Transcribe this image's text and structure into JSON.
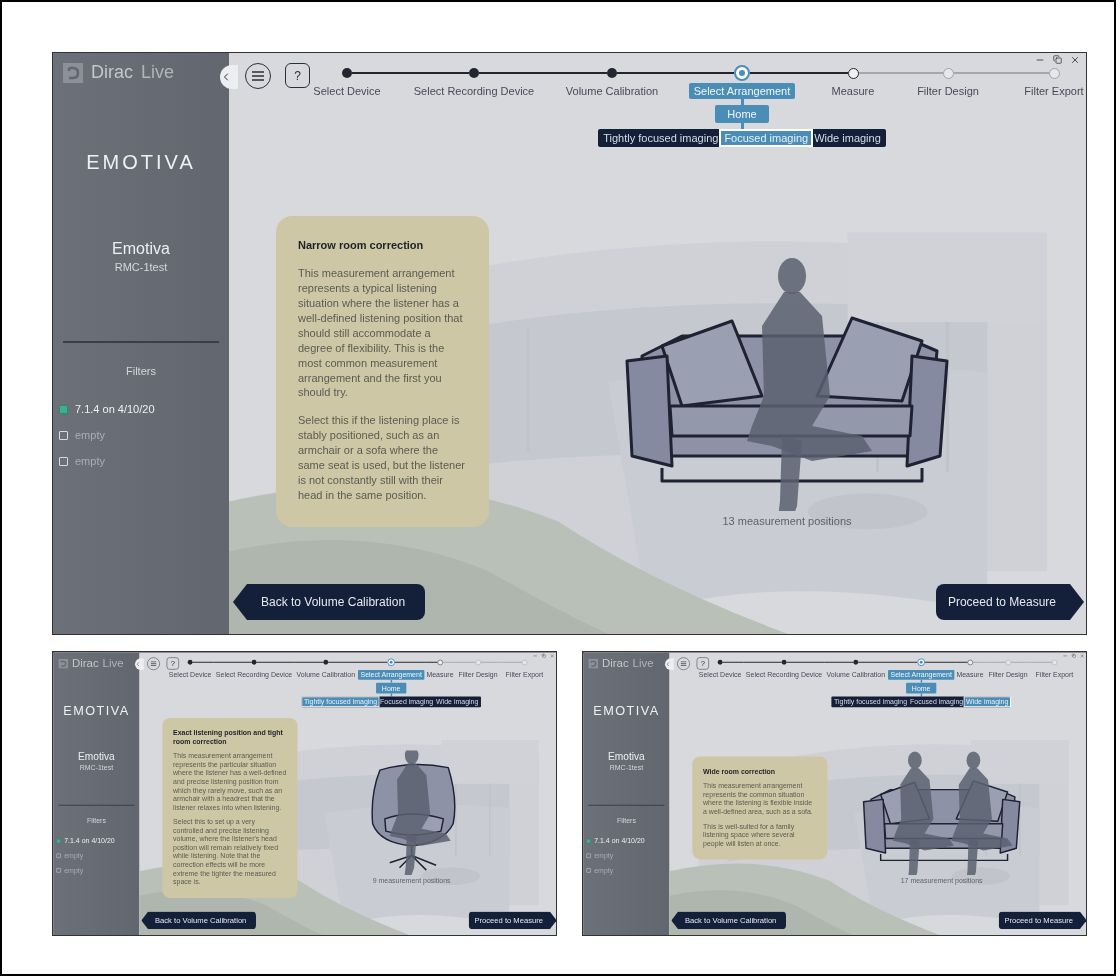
{
  "screens": [
    {
      "sidebar": {
        "brand": "Dirac",
        "brand_suffix": "Live",
        "logo": "EMOTIVA",
        "device_name": "Emotiva",
        "device_model": "RMC-1test",
        "filters_heading": "Filters",
        "filters": [
          {
            "label": "7.1.4 on 4/10/20",
            "checked": true
          },
          {
            "label": "empty",
            "checked": false
          },
          {
            "label": "empty",
            "checked": false
          }
        ]
      },
      "help_label": "?",
      "steps": [
        {
          "label": "Select Device",
          "completed": true,
          "selected": false,
          "enabled": true
        },
        {
          "label": "Select Recording Device",
          "completed": true,
          "selected": false,
          "enabled": true
        },
        {
          "label": "Volume Calibration",
          "completed": true,
          "selected": false,
          "enabled": true
        },
        {
          "label": "Select Arrangement",
          "completed": false,
          "selected": true,
          "enabled": true
        },
        {
          "label": "Measure",
          "completed": false,
          "selected": false,
          "enabled": true
        },
        {
          "label": "Filter Design",
          "completed": false,
          "selected": false,
          "enabled": false
        },
        {
          "label": "Filter Export",
          "completed": false,
          "selected": false,
          "enabled": false
        }
      ],
      "substep": "Home",
      "options": [
        {
          "label": "Tightly focused imaging",
          "selected": false
        },
        {
          "label": "Focused imaging",
          "selected": true
        },
        {
          "label": "Wide imaging",
          "selected": false
        }
      ],
      "card": {
        "title": "Narrow room correction",
        "paragraphs": [
          "This measurement arrangement represents a typical listening situation where the listener has a well-defined listening position that should still accommodate a degree of flexibility. This is the most common measurement arrangement and the first you should try.",
          "Select this if the listening place is stably positioned, such as an armchair or a sofa where the same seat is used, but the listener is not constantly still with their head in the same position."
        ]
      },
      "scene": {
        "kind": "sofa-single"
      },
      "positions": "13 measurement positions",
      "back_button": "Back to Volume Calibration",
      "proceed_button": "Proceed to Measure"
    },
    {
      "sidebar": {
        "brand": "Dirac",
        "brand_suffix": "Live",
        "logo": "EMOTIVA",
        "device_name": "Emotiva",
        "device_model": "RMC-1test",
        "filters_heading": "Filters",
        "filters": [
          {
            "label": "7.1.4 on 4/10/20",
            "checked": true
          },
          {
            "label": "empty",
            "checked": false
          },
          {
            "label": "empty",
            "checked": false
          }
        ]
      },
      "help_label": "?",
      "steps": [
        {
          "label": "Select Device",
          "completed": true,
          "selected": false,
          "enabled": true
        },
        {
          "label": "Select Recording Device",
          "completed": true,
          "selected": false,
          "enabled": true
        },
        {
          "label": "Volume Calibration",
          "completed": true,
          "selected": false,
          "enabled": true
        },
        {
          "label": "Select Arrangement",
          "completed": false,
          "selected": true,
          "enabled": true
        },
        {
          "label": "Measure",
          "completed": false,
          "selected": false,
          "enabled": true
        },
        {
          "label": "Filter Design",
          "completed": false,
          "selected": false,
          "enabled": false
        },
        {
          "label": "Filter Export",
          "completed": false,
          "selected": false,
          "enabled": false
        }
      ],
      "substep": "Home",
      "options": [
        {
          "label": "Tightly focused imaging",
          "selected": true
        },
        {
          "label": "Focused imaging",
          "selected": false
        },
        {
          "label": "Wide imaging",
          "selected": false
        }
      ],
      "card": {
        "title": "Exact listening position and tight room correction",
        "paragraphs": [
          "This measurement arrangement represents the particular situation where the listener has a well-defined and precise listening position from which they rarely move, such as an armchair with a headrest that the listener relaxes into when listening.",
          "Select this to set up a very controlled and precise listening volume, where the listener's head position will remain relatively fixed while listening. Note that the correction effects will be more extreme the tighter the measured space is."
        ]
      },
      "scene": {
        "kind": "armchair"
      },
      "positions": "9 measurement positions",
      "back_button": "Back to Volume Calibration",
      "proceed_button": "Proceed to Measure"
    },
    {
      "sidebar": {
        "brand": "Dirac",
        "brand_suffix": "Live",
        "logo": "EMOTIVA",
        "device_name": "Emotiva",
        "device_model": "RMC-1test",
        "filters_heading": "Filters",
        "filters": [
          {
            "label": "7.1.4 on 4/10/20",
            "checked": true
          },
          {
            "label": "empty",
            "checked": false
          },
          {
            "label": "empty",
            "checked": false
          }
        ]
      },
      "help_label": "?",
      "steps": [
        {
          "label": "Select Device",
          "completed": true,
          "selected": false,
          "enabled": true
        },
        {
          "label": "Select Recording Device",
          "completed": true,
          "selected": false,
          "enabled": true
        },
        {
          "label": "Volume Calibration",
          "completed": true,
          "selected": false,
          "enabled": true
        },
        {
          "label": "Select Arrangement",
          "completed": false,
          "selected": true,
          "enabled": true
        },
        {
          "label": "Measure",
          "completed": false,
          "selected": false,
          "enabled": true
        },
        {
          "label": "Filter Design",
          "completed": false,
          "selected": false,
          "enabled": false
        },
        {
          "label": "Filter Export",
          "completed": false,
          "selected": false,
          "enabled": false
        }
      ],
      "substep": "Home",
      "options": [
        {
          "label": "Tightly focused imaging",
          "selected": false
        },
        {
          "label": "Focused imaging",
          "selected": false
        },
        {
          "label": "Wide imaging",
          "selected": true
        }
      ],
      "card": {
        "title": "Wide room correction",
        "paragraphs": [
          "This measurement arrangement represents the common situation where the listening is flexible inside a well-defined area, such as a sofa.",
          "This is well-suited for a family listening space where several people will listen at once."
        ]
      },
      "scene": {
        "kind": "sofa-double"
      },
      "positions": "17 measurement positions",
      "back_button": "Back to Volume Calibration",
      "proceed_button": "Proceed to Measure"
    }
  ]
}
